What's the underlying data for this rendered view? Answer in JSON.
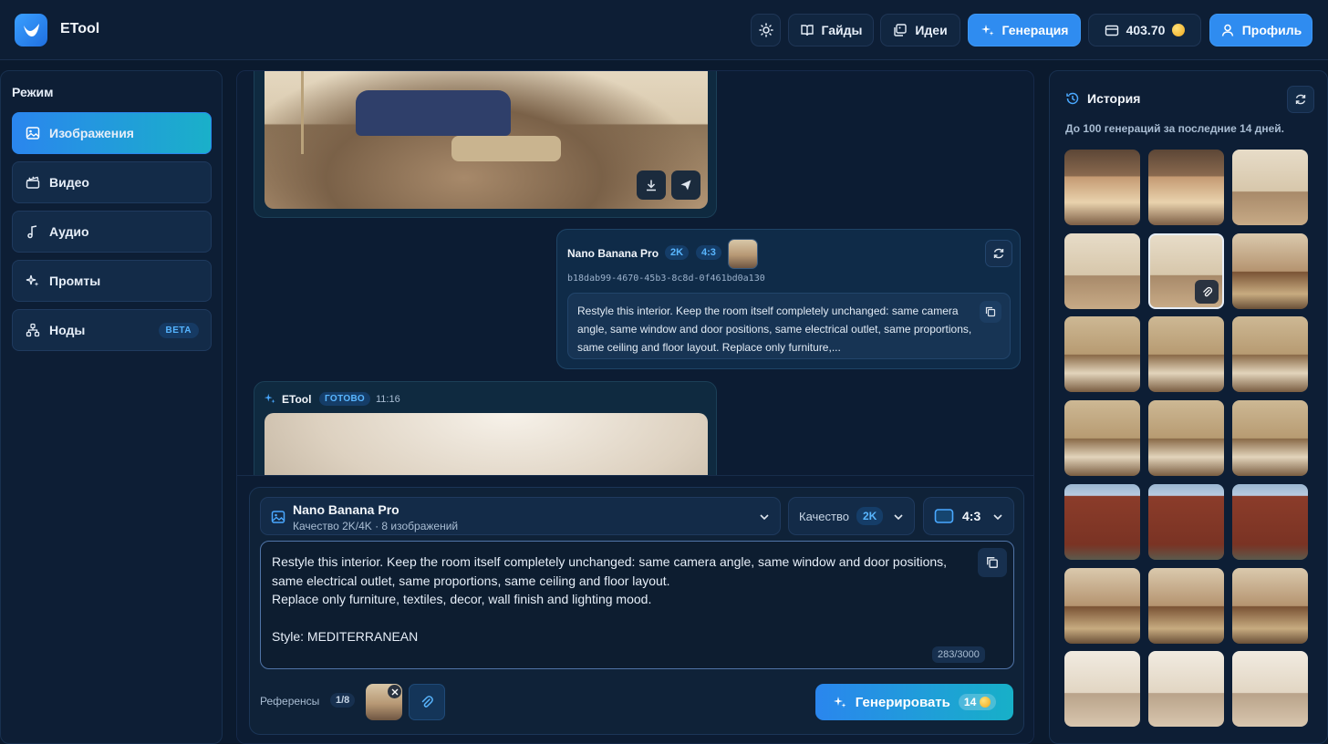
{
  "header": {
    "app_title": "ETool",
    "nav": {
      "guides": "Гайды",
      "ideas": "Идеи",
      "generation": "Генерация"
    },
    "balance": "403.70",
    "profile": "Профиль"
  },
  "sidebar": {
    "heading": "Режим",
    "items": [
      {
        "label": "Изображения"
      },
      {
        "label": "Видео"
      },
      {
        "label": "Аудио"
      },
      {
        "label": "Промты"
      },
      {
        "label": "Ноды",
        "badge": "BETA"
      }
    ]
  },
  "chat": {
    "request": {
      "model": "Nano Banana Pro",
      "quality_badge": "2K",
      "ratio_badge": "4:3",
      "id": "b18dab99-4670-45b3-8c8d-0f461bd0a130",
      "prompt_preview": "Restyle this interior. Keep the room itself completely unchanged: same camera angle, same window and door positions, same electrical outlet, same proportions, same ceiling and floor layout. Replace only furniture,..."
    },
    "response": {
      "sender": "ETool",
      "status": "ГОТОВО",
      "time": "11:16"
    }
  },
  "composer": {
    "model": {
      "name": "Nano Banana Pro",
      "subtitle": "Качество 2K/4K · 8 изображений"
    },
    "quality": {
      "label": "Качество",
      "value": "2K"
    },
    "ratio": "4:3",
    "prompt": "Restyle this interior. Keep the room itself completely unchanged: same camera angle, same window and door positions, same electrical outlet, same proportions, same ceiling and floor layout.\nReplace only furniture, textiles, decor, wall finish and lighting mood.\n\nStyle: MEDITERRANEAN",
    "char_count": "283/3000",
    "references": {
      "label": "Референсы",
      "count": "1/8"
    },
    "generate": {
      "label": "Генерировать",
      "cost": "14"
    }
  },
  "history": {
    "title": "История",
    "subtitle": "До 100 генераций за последние 14 дней."
  },
  "colors": {
    "background": "#0b1a2e",
    "panel": "#0d1e35",
    "accent": "#2f8cf0",
    "accent_gradient_end": "#17b0c8",
    "badge_text": "#59b6ff",
    "coin": "#f0a81c"
  },
  "icons": {
    "theme": "sun-icon",
    "guides": "book-icon",
    "ideas": "images-icon",
    "generation": "sparkles-icon",
    "balance": "wallet-icon",
    "profile": "user-icon",
    "history": "history-icon",
    "refresh": "refresh-icon",
    "download": "download-icon",
    "share": "send-icon",
    "copy": "copy-icon",
    "attach": "paperclip-icon"
  }
}
